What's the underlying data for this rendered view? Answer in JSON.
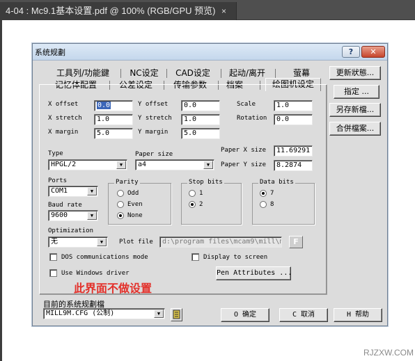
{
  "app_tab": {
    "title": "4-04 : Mc9.1基本设置.pdf @ 100% (RGB/GPU 预览)",
    "close": "×"
  },
  "dialog": {
    "title": "系统规劃",
    "help": "?",
    "close": "✕",
    "tabs_row1": [
      "工具列/功能鍵",
      "NC设定",
      "CAD设定",
      "起动/离开",
      "萤幕"
    ],
    "tabs_row2": [
      "记忆体配置",
      "公差设定",
      "传输参数",
      "档案",
      "绘图机设定"
    ],
    "side_buttons": [
      "更新狀態...",
      "指定 ...",
      "另存新檔...",
      "合併檔案..."
    ],
    "fields": {
      "x_offset": {
        "label": "X offset",
        "value": "0.0"
      },
      "y_offset": {
        "label": "Y offset",
        "value": "0.0"
      },
      "scale": {
        "label": "Scale",
        "value": "1.0"
      },
      "x_stretch": {
        "label": "X stretch",
        "value": "1.0"
      },
      "y_stretch": {
        "label": "Y stretch",
        "value": "1.0"
      },
      "rotation": {
        "label": "Rotation",
        "value": "0.0"
      },
      "x_margin": {
        "label": "X margin",
        "value": "5.0"
      },
      "y_margin": {
        "label": "Y margin",
        "value": "5.0"
      },
      "paper_x": {
        "label": "Paper X size",
        "value": "11.69291"
      },
      "paper_y": {
        "label": "Paper Y size",
        "value": "8.2874"
      }
    },
    "type": {
      "label": "Type",
      "value": "HPGL/2"
    },
    "paper_size": {
      "label": "Paper size",
      "value": "a4"
    },
    "ports": {
      "label": "Ports",
      "value": "COM1"
    },
    "baud_rate": {
      "label": "Baud rate",
      "value": "9600"
    },
    "parity": {
      "title": "Parity",
      "options": [
        "Odd",
        "Even",
        "None"
      ],
      "selected": "None"
    },
    "stop_bits": {
      "title": "Stop bits",
      "options": [
        "1",
        "2"
      ],
      "selected": "2"
    },
    "data_bits": {
      "title": "Data bits",
      "options": [
        "7",
        "8"
      ],
      "selected": "7"
    },
    "optimization": {
      "label": "Optimization",
      "value": "无"
    },
    "plot_file": {
      "label": "Plot file",
      "value": "d:\\program files\\mcam9\\mill\\m"
    },
    "file_browse": "F",
    "dos_mode": {
      "label": "DOS communications mode",
      "checked": false
    },
    "display_screen": {
      "label": "Display to screen",
      "checked": false
    },
    "windows_driver": {
      "label": "Use Windows driver",
      "checked": false
    },
    "pen_attributes": "Pen Attributes ...",
    "note": "此界面不做设置",
    "current_config_label": "目前的系统规劃檔",
    "current_config_value": "MILL9M.CFG (公制)",
    "ok": "O 确定",
    "cancel": "C 取消",
    "help_btn": "H 帮助"
  },
  "watermark": "RJZXW.COM"
}
